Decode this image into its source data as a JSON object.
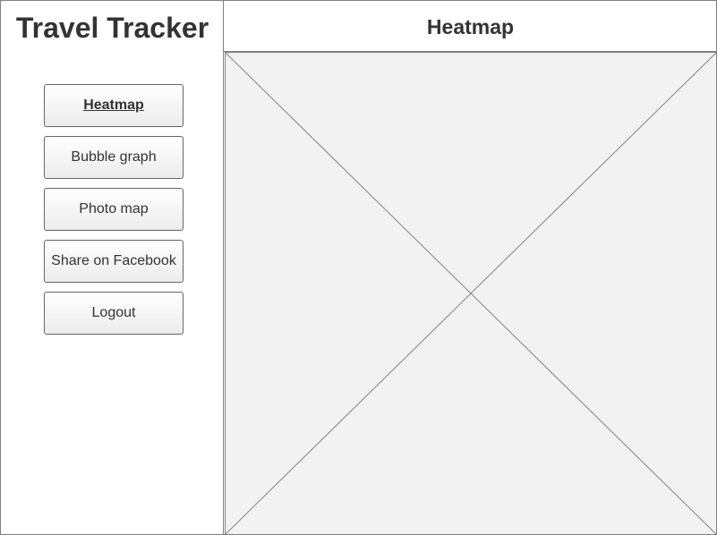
{
  "app": {
    "title": "Travel Tracker"
  },
  "sidebar": {
    "nav": [
      {
        "label": "Heatmap",
        "active": true
      },
      {
        "label": "Bubble graph",
        "active": false
      },
      {
        "label": "Photo map",
        "active": false
      },
      {
        "label": "Share on Facebook",
        "active": false
      },
      {
        "label": "Logout",
        "active": false
      }
    ]
  },
  "main": {
    "title": "Heatmap",
    "content_placeholder": "image-placeholder-icon"
  },
  "colors": {
    "border": "#808080",
    "placeholder_bg": "#f2f2f2",
    "text": "#333333"
  }
}
